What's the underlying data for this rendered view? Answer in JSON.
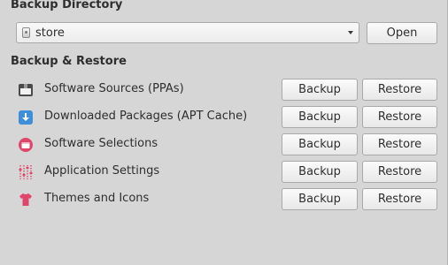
{
  "backup_directory": {
    "title": "Backup Directory",
    "selected": "store",
    "open_label": "Open"
  },
  "backup_restore": {
    "title": "Backup & Restore",
    "items": [
      {
        "label": "Software Sources (PPAs)",
        "icon": "package-icon",
        "backup_label": "Backup",
        "restore_label": "Restore"
      },
      {
        "label": "Downloaded Packages (APT Cache)",
        "icon": "download-icon",
        "backup_label": "Backup",
        "restore_label": "Restore"
      },
      {
        "label": "Software Selections",
        "icon": "software-center-icon",
        "backup_label": "Backup",
        "restore_label": "Restore"
      },
      {
        "label": "Application Settings",
        "icon": "settings-sliders-icon",
        "backup_label": "Backup",
        "restore_label": "Restore"
      },
      {
        "label": "Themes and Icons",
        "icon": "tshirt-icon",
        "backup_label": "Backup",
        "restore_label": "Restore"
      }
    ]
  },
  "colors": {
    "background": "#d6d6d6",
    "download_icon": "#3f8fd8",
    "accent_pink": "#e0456a"
  }
}
